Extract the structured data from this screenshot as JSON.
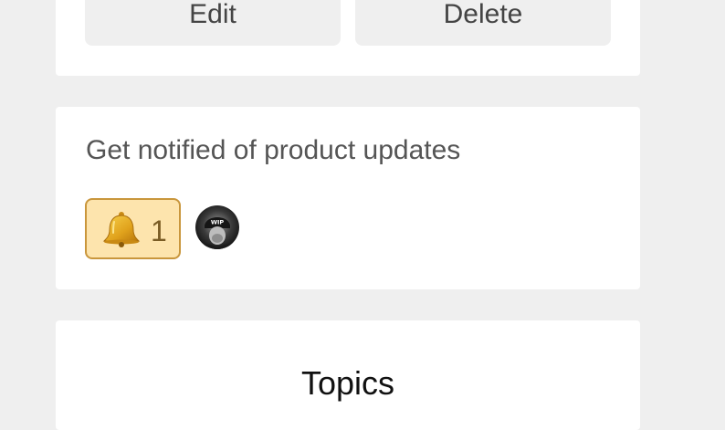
{
  "actions": {
    "edit_label": "Edit",
    "delete_label": "Delete"
  },
  "notify": {
    "title": "Get notified of product updates",
    "reaction": {
      "icon": "bell-icon",
      "count": "1"
    },
    "avatar": {
      "badge_text": "WIP"
    }
  },
  "topics": {
    "title": "Topics"
  }
}
